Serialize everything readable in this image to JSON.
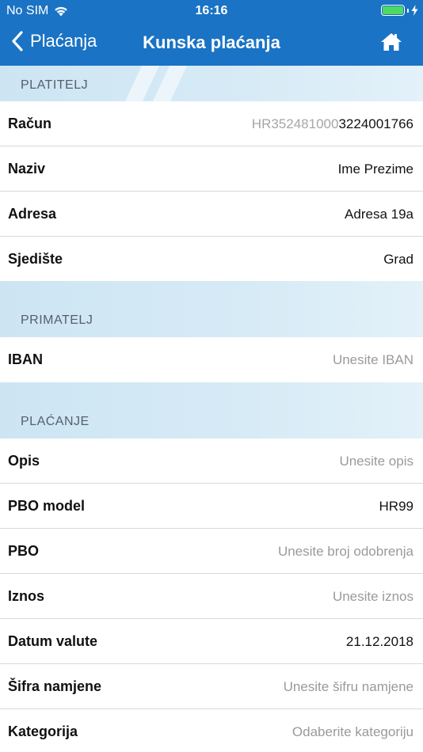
{
  "status_bar": {
    "carrier": "No SIM",
    "time": "16:16"
  },
  "nav": {
    "back_label": "Plaćanja",
    "title": "Kunska plaćanja"
  },
  "colors": {
    "nav_background": "#1a73c4",
    "section_background": "#d7ebf6",
    "placeholder_text": "#9a9a9a"
  },
  "sections": {
    "platitelj": {
      "header": "PLATITELJ",
      "rows": [
        {
          "label": "Račun",
          "value_prefix": "HR352481000",
          "value": "3224001766"
        },
        {
          "label": "Naziv",
          "value": "Ime Prezime"
        },
        {
          "label": "Adresa",
          "value": "Adresa 19a"
        },
        {
          "label": "Sjedište",
          "value": "Grad"
        }
      ]
    },
    "primatelj": {
      "header": "PRIMATELJ",
      "rows": [
        {
          "label": "IBAN",
          "placeholder": "Unesite IBAN"
        }
      ]
    },
    "placanje": {
      "header": "PLAĆANJE",
      "rows": [
        {
          "label": "Opis",
          "placeholder": "Unesite opis"
        },
        {
          "label": "PBO model",
          "value": "HR99"
        },
        {
          "label": "PBO",
          "placeholder": "Unesite broj odobrenja"
        },
        {
          "label": "Iznos",
          "placeholder": "Unesite iznos"
        },
        {
          "label": "Datum valute",
          "value": "21.12.2018"
        },
        {
          "label": "Šifra namjene",
          "placeholder": "Unesite šifru namjene"
        },
        {
          "label": "Kategorija",
          "placeholder": "Odaberite kategoriju"
        }
      ]
    }
  },
  "icons": {
    "back": "chevron-left-icon",
    "home": "home-icon",
    "wifi": "wifi-icon",
    "battery": "battery-icon",
    "charging": "charging-bolt-icon"
  }
}
